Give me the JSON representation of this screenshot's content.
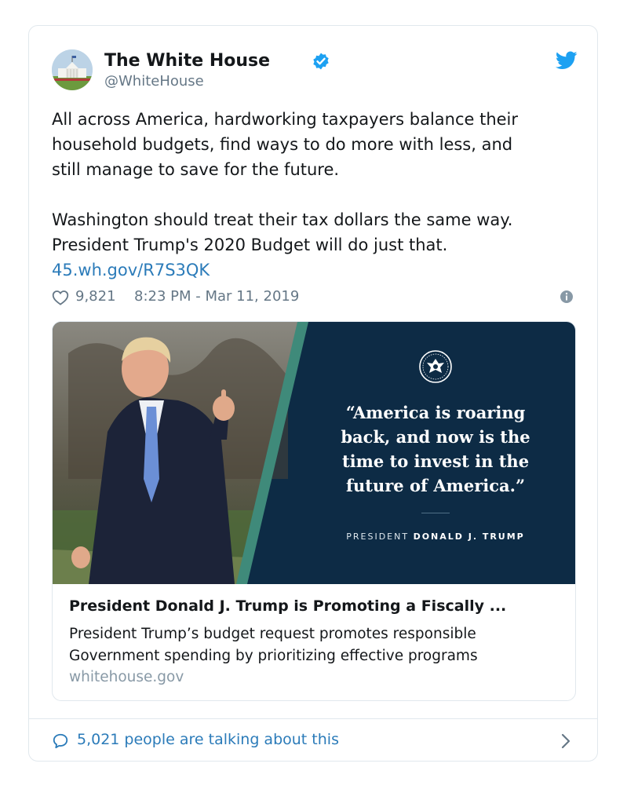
{
  "tweet": {
    "display_name": "The White House",
    "handle": "@WhiteHouse",
    "text": "All across America, hardworking taxpayers balance their\nhousehold budgets, find ways to do more with less, and\nstill manage to save for the future.\n\nWashington should treat their tax dollars the same way.\nPresident Trump's 2020 Budget will do just that.",
    "link": "45.wh.gov/R7S3QK",
    "likes": "9,821",
    "timestamp": "8:23 PM - Mar 11, 2019"
  },
  "link_card": {
    "quote": "“America is roaring back, and now is the time to invest in the future of America.”",
    "attribution_prefix": "PRESIDENT",
    "attribution_name": "DONALD J. TRUMP",
    "title": "President Donald J. Trump is Promoting a Fiscally ...",
    "description": "President Trump’s budget request promotes responsible Government spending by prioritizing effective programs",
    "domain": "whitehouse.gov"
  },
  "footer": {
    "talking": "5,021 people are talking about this"
  },
  "colors": {
    "link_blue": "#2b7bb9",
    "twitter_blue": "#1da1f2",
    "navy_panel": "#0d2b45"
  },
  "icons": [
    "white-house-avatar",
    "verified-badge-icon",
    "twitter-bird-icon",
    "heart-icon",
    "info-icon",
    "presidential-seal-icon",
    "comment-bubble-icon",
    "chevron-right-icon"
  ]
}
